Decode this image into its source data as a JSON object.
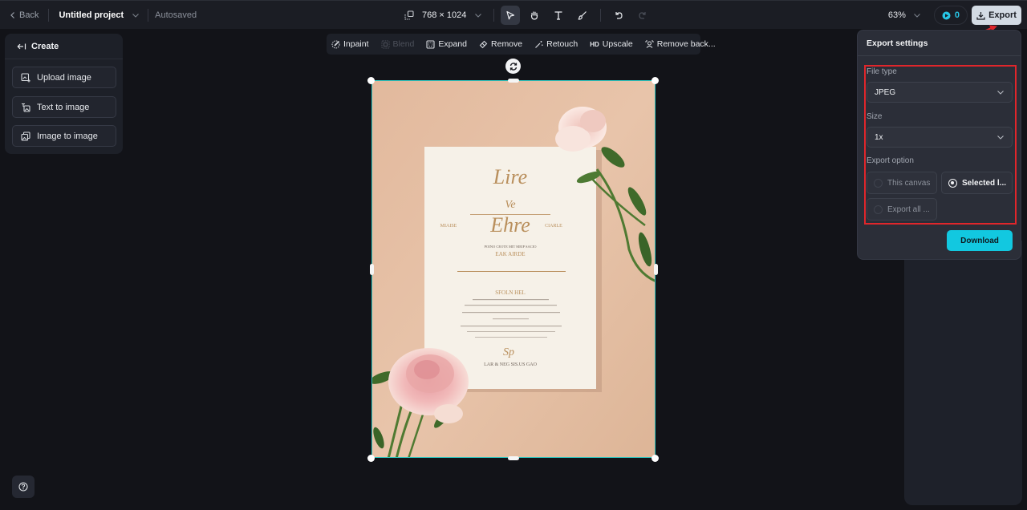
{
  "topbar": {
    "back_label": "Back",
    "project_title": "Untitled project",
    "save_status": "Autosaved",
    "canvas_size": "768 × 1024",
    "zoom_level": "63%",
    "credits": "0",
    "export_label": "Export",
    "tools": [
      {
        "name": "select-tool",
        "icon": "cursor-arrow-icon",
        "active": true
      },
      {
        "name": "hand-tool",
        "icon": "hand-icon",
        "active": false
      },
      {
        "name": "text-tool",
        "icon": "text-icon",
        "active": false
      },
      {
        "name": "brush-tool",
        "icon": "brush-icon",
        "active": false
      },
      {
        "name": "undo",
        "icon": "undo-icon",
        "active": false
      },
      {
        "name": "redo",
        "icon": "redo-icon",
        "active": false
      }
    ]
  },
  "create_panel": {
    "title": "Create",
    "items": [
      {
        "label": "Upload image",
        "icon": "upload-image-icon"
      },
      {
        "label": "Text to image",
        "icon": "text-to-image-icon"
      },
      {
        "label": "Image to image",
        "icon": "image-to-image-icon"
      }
    ]
  },
  "edit_toolbar": {
    "items": [
      {
        "label": "Inpaint",
        "icon": "inpaint-icon",
        "disabled": false
      },
      {
        "label": "Blend",
        "icon": "blend-icon",
        "disabled": true
      },
      {
        "label": "Expand",
        "icon": "expand-icon",
        "disabled": false
      },
      {
        "label": "Remove",
        "icon": "eraser-icon",
        "disabled": false
      },
      {
        "label": "Retouch",
        "icon": "magic-wand-icon",
        "disabled": false
      },
      {
        "label": "Upscale",
        "icon": "hd-icon",
        "disabled": false
      },
      {
        "label": "Remove back...",
        "icon": "remove-background-icon",
        "disabled": false
      }
    ]
  },
  "canvas": {
    "image_description": "Wedding invitation card on peach textured background with pink roses",
    "selection_color": "#2ec6c0",
    "invitation_lines": {
      "script_top": "Lire",
      "script_mid": "Ve",
      "left_name": "MIAISE",
      "script_name": "Ehre",
      "right_name": "CIARLE",
      "line1": "POINO CEOTE MIT MEIP SACIO",
      "line2": "EAK AIRDE",
      "line3": "SFOLN HEL",
      "line4": "LAR & NEG SIS.US GAO"
    }
  },
  "export_settings": {
    "title": "Export settings",
    "file_type_label": "File type",
    "file_type_value": "JPEG",
    "size_label": "Size",
    "size_value": "1x",
    "export_option_label": "Export option",
    "options": [
      {
        "label": "This canvas",
        "selected": false
      },
      {
        "label": "Selected l...",
        "selected": true
      },
      {
        "label": "Export all ...",
        "selected": false
      }
    ],
    "download_label": "Download"
  },
  "colors": {
    "accent": "#12c8e0",
    "highlight": "#e0262b",
    "background": "#121318"
  }
}
